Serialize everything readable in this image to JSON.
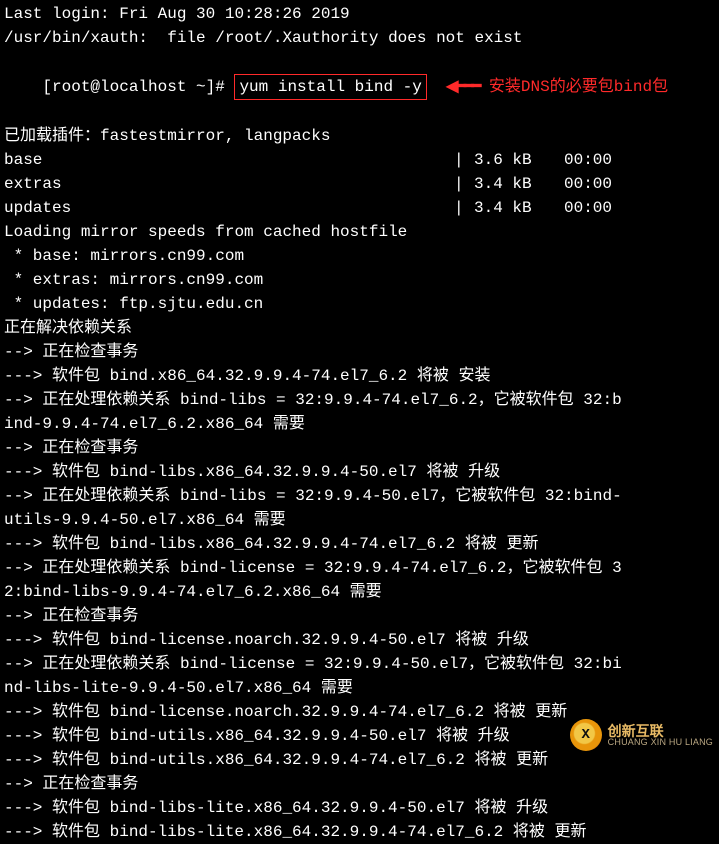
{
  "last_login": "Last login: Fri Aug 30 10:28:26 2019",
  "xauth_msg": "/usr/bin/xauth:  file /root/.Xauthority does not exist",
  "prompt": "[root@localhost ~]# ",
  "command": "yum install bind -y",
  "annotation_arrow": "◀━━━",
  "annotation_text": "安装DNS的必要包bind包",
  "loaded_plugins": "已加载插件：fastestmirror, langpacks",
  "repos": [
    {
      "name": "base",
      "size": "3.6 kB",
      "time": "00:00"
    },
    {
      "name": "extras",
      "size": "3.4 kB",
      "time": "00:00"
    },
    {
      "name": "updates",
      "size": "3.4 kB",
      "time": "00:00"
    }
  ],
  "mirror_loading": "Loading mirror speeds from cached hostfile",
  "mirrors": [
    " * base: mirrors.cn99.com",
    " * extras: mirrors.cn99.com",
    " * updates: ftp.sjtu.edu.cn"
  ],
  "log_lines": [
    "正在解决依赖关系",
    "--> 正在检查事务",
    "---> 软件包 bind.x86_64.32.9.9.4-74.el7_6.2 将被 安装",
    "--> 正在处理依赖关系 bind-libs = 32:9.9.4-74.el7_6.2，它被软件包 32:b",
    "ind-9.9.4-74.el7_6.2.x86_64 需要",
    "--> 正在检查事务",
    "---> 软件包 bind-libs.x86_64.32.9.9.4-50.el7 将被 升级",
    "--> 正在处理依赖关系 bind-libs = 32:9.9.4-50.el7，它被软件包 32:bind-",
    "utils-9.9.4-50.el7.x86_64 需要",
    "---> 软件包 bind-libs.x86_64.32.9.9.4-74.el7_6.2 将被 更新",
    "--> 正在处理依赖关系 bind-license = 32:9.9.4-74.el7_6.2，它被软件包 3",
    "2:bind-libs-9.9.4-74.el7_6.2.x86_64 需要",
    "--> 正在检查事务",
    "---> 软件包 bind-license.noarch.32.9.9.4-50.el7 将被 升级",
    "--> 正在处理依赖关系 bind-license = 32:9.9.4-50.el7，它被软件包 32:bi",
    "nd-libs-lite-9.9.4-50.el7.x86_64 需要",
    "---> 软件包 bind-license.noarch.32.9.9.4-74.el7_6.2 将被 更新",
    "---> 软件包 bind-utils.x86_64.32.9.9.4-50.el7 将被 升级",
    "---> 软件包 bind-utils.x86_64.32.9.9.4-74.el7_6.2 将被 更新",
    "--> 正在检查事务",
    "---> 软件包 bind-libs-lite.x86_64.32.9.9.4-50.el7 将被 升级",
    "---> 软件包 bind-libs-lite.x86_64.32.9.9.4-74.el7_6.2 将被 更新"
  ],
  "repo_sep": "|",
  "watermark": {
    "icon": "X",
    "cn": "创新互联",
    "en": "CHUANG XIN HU LIANG"
  }
}
